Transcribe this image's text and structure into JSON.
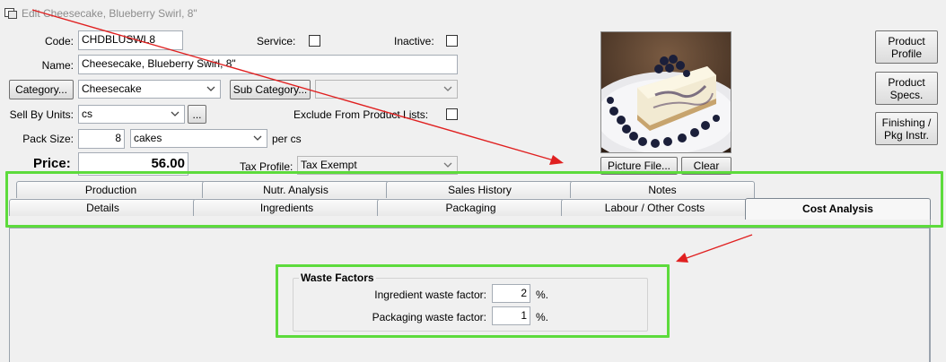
{
  "window": {
    "title": "Edit Cheesecake, Blueberry Swirl, 8\""
  },
  "form": {
    "code_label": "Code:",
    "code_value": "CHDBLUSWL8",
    "service_label": "Service:",
    "inactive_label": "Inactive:",
    "name_label": "Name:",
    "name_value": "Cheesecake, Blueberry Swirl, 8\"",
    "category_button": "Category...",
    "category_value": "Cheesecake",
    "subcategory_button": "Sub Category...",
    "subcategory_value": "",
    "sell_by_label": "Sell By Units:",
    "sell_by_value": "cs",
    "sell_by_more": "...",
    "exclude_label": "Exclude From Product Lists:",
    "pack_size_label": "Pack Size:",
    "pack_size_value": "8",
    "pack_unit_value": "cakes",
    "per_label": "per cs",
    "price_label": "Price:",
    "price_value": "56.00",
    "tax_label": "Tax Profile:",
    "tax_value": "Tax Exempt"
  },
  "picture": {
    "picture_button": "Picture File...",
    "clear_button": "Clear"
  },
  "side_buttons": [
    "Product Profile",
    "Product Specs.",
    "Finishing / Pkg Instr."
  ],
  "tabs_top": [
    "Production",
    "Nutr. Analysis",
    "Sales History",
    "Notes"
  ],
  "tabs_bottom": [
    "Details",
    "Ingredients",
    "Packaging",
    "Labour / Other Costs",
    "Cost Analysis"
  ],
  "active_tab": "Cost Analysis",
  "waste": {
    "title": "Waste Factors",
    "ingredient_label": "Ingredient waste factor:",
    "ingredient_value": "2",
    "packaging_label": "Packaging waste factor:",
    "packaging_value": "1",
    "percent_unit": "%."
  },
  "colors": {
    "highlight": "#5ddb3c",
    "arrow": "#e02020"
  }
}
